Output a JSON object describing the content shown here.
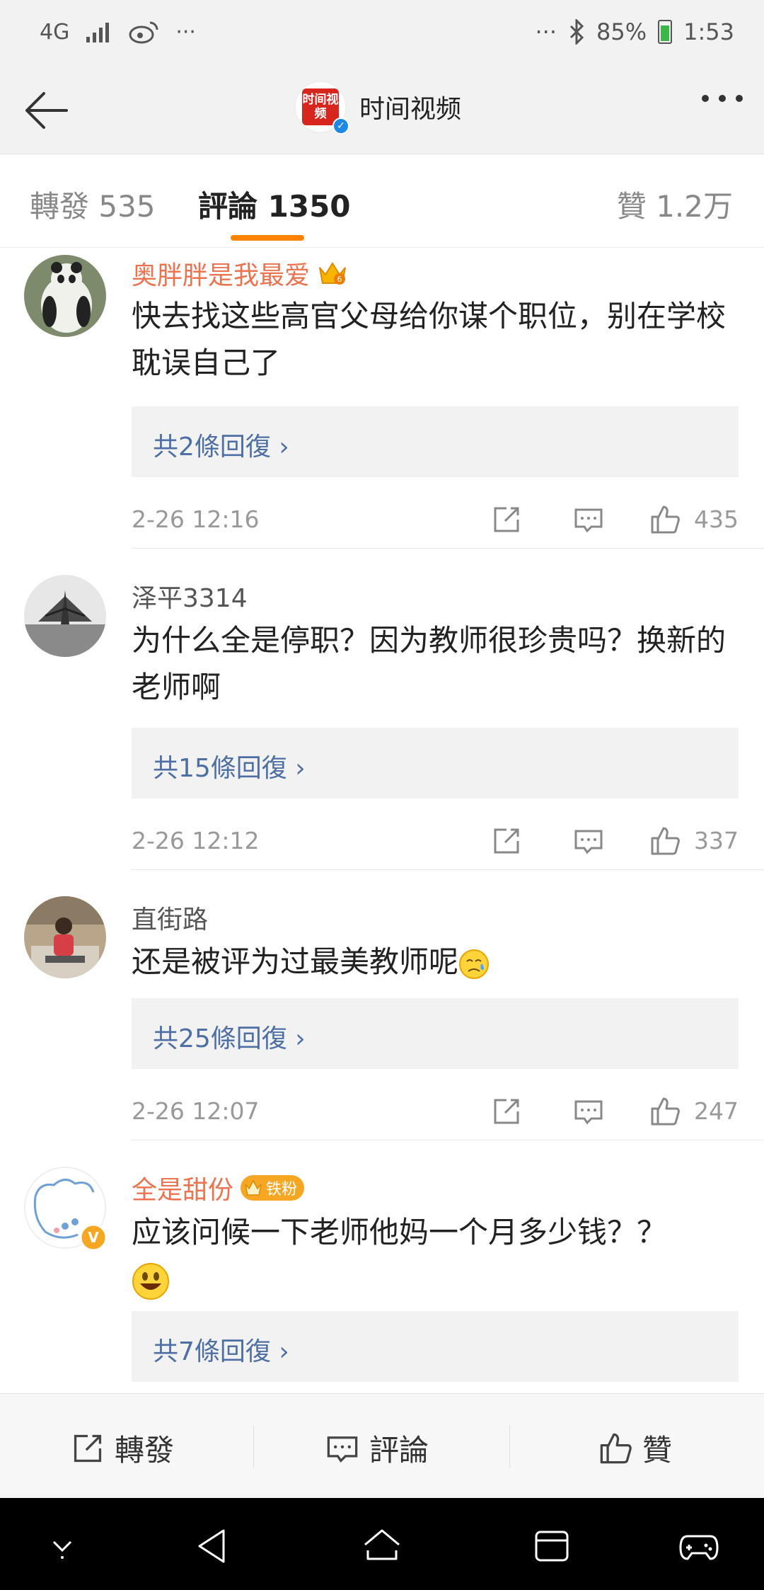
{
  "status_bar": {
    "network": "4G",
    "more": "···",
    "right_more": "···",
    "battery": "85%",
    "time": "1:53"
  },
  "header": {
    "logo_text": "时间视频",
    "title": "时间视频"
  },
  "tabs": {
    "repost": "轉發 535",
    "comments": "評論 1350",
    "likes": "贊 1.2万"
  },
  "comments": [
    {
      "username": "奥胖胖是我最爱",
      "text": "快去找这些高官父母给你谋个职位，别在学校耽误自己了",
      "replies": "共2條回復 ›",
      "time": "2-26 12:16",
      "likes": "435"
    },
    {
      "username": "泽平3314",
      "text": "为什么全是停职？因为教师很珍贵吗？换新的老师啊",
      "replies": "共15條回復 ›",
      "time": "2-26 12:12",
      "likes": "337"
    },
    {
      "username": "直街路",
      "text": "还是被评为过最美教师呢",
      "replies": "共25條回復 ›",
      "time": "2-26 12:07",
      "likes": "247"
    },
    {
      "username": "全是甜份",
      "badge": "铁粉",
      "text": "应该问候一下老师他妈一个月多少钱？？",
      "replies": "共7條回復 ›"
    }
  ],
  "action_bar": {
    "repost": "轉發",
    "comment": "評論",
    "like": "贊"
  },
  "colors": {
    "accent": "#ff8200",
    "vip_name": "#eb7350",
    "reply_link": "#4d6fa3"
  }
}
